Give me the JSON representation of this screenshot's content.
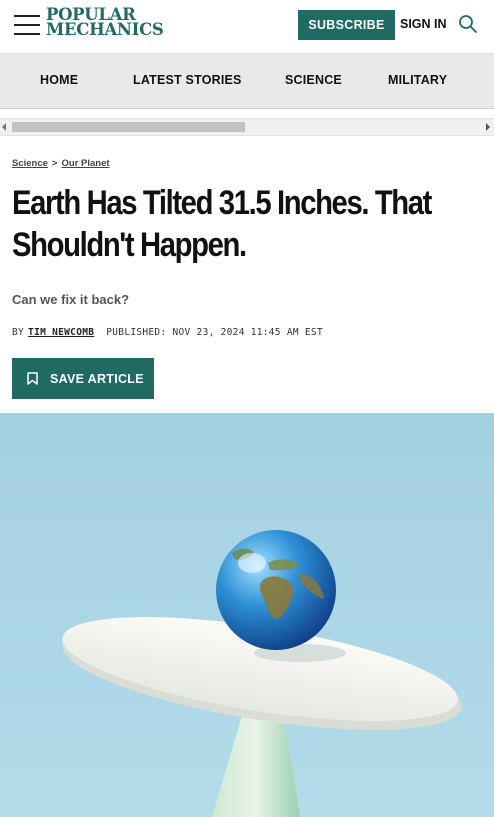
{
  "header": {
    "logo_line1": "Popular",
    "logo_line2": "Mechanics",
    "subscribe_label": "SUBSCRIBE",
    "signin_label": "SIGN IN"
  },
  "nav": {
    "items": [
      {
        "label": "HOME"
      },
      {
        "label": "LATEST STORIES"
      },
      {
        "label": "SCIENCE"
      },
      {
        "label": "MILITARY"
      }
    ]
  },
  "breadcrumb": {
    "items": [
      {
        "label": "Science"
      },
      {
        "label": "Our Planet"
      }
    ],
    "separator": ">"
  },
  "article": {
    "headline": "Earth Has Tilted 31.5 Inches. That Shouldn't Happen.",
    "dek": "Can we fix it back?",
    "by_label": "BY",
    "author": "TIM NEWCOMB",
    "published": "PUBLISHED: NOV 23, 2024 11:45 AM EST",
    "save_label": "SAVE ARTICLE"
  },
  "icons": {
    "menu": "hamburger-icon",
    "search": "search-icon",
    "bookmark": "bookmark-icon"
  },
  "colors": {
    "brand": "#1f6b63",
    "nav_bg": "#e9e9e9",
    "hero_bg": "#a9d6e5"
  }
}
